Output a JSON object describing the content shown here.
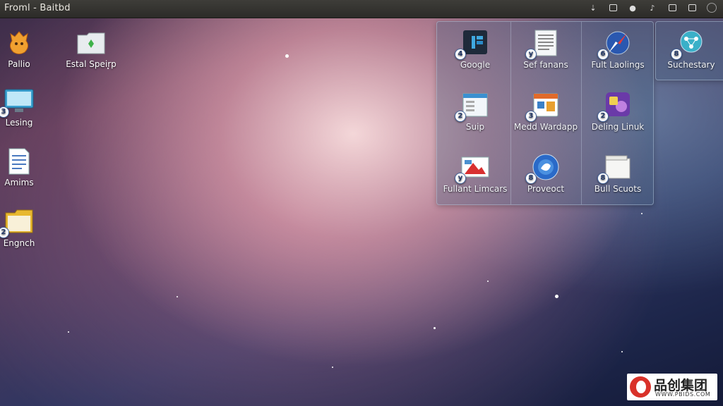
{
  "topbar": {
    "title": "Froml - Baitbd"
  },
  "desktop_icons": [
    {
      "label": "Pallio",
      "icon": "flame-mascot-icon",
      "badge": ""
    },
    {
      "label": "Estal Speirp",
      "icon": "folder-green-icon",
      "badge": ""
    },
    {
      "label": "Lesing",
      "icon": "monitor-icon",
      "badge": "3"
    },
    {
      "label": "Amims",
      "icon": "document-icon",
      "badge": ""
    },
    {
      "label": "Engnch",
      "icon": "folder-icon",
      "badge": "2"
    }
  ],
  "launcher": {
    "cells": [
      {
        "label": "Google",
        "icon": "app-window-icon",
        "badge": "4"
      },
      {
        "label": "Sef fanans",
        "icon": "text-document-icon",
        "badge": "y"
      },
      {
        "label": "Fult Laolings",
        "icon": "compass-icon",
        "badge": "6"
      },
      {
        "label": "Suip",
        "icon": "spreadsheet-icon",
        "badge": "2"
      },
      {
        "label": "Medd Wardapp",
        "icon": "media-app-icon",
        "badge": "3"
      },
      {
        "label": "Deling Linuk",
        "icon": "purple-app-icon",
        "badge": "2"
      },
      {
        "label": "Fullant Limcars",
        "icon": "image-viewer-icon",
        "badge": "y"
      },
      {
        "label": "Proveoct",
        "icon": "globe-icon",
        "badge": "8"
      },
      {
        "label": "Bull Scuots",
        "icon": "white-folder-icon",
        "badge": "8"
      }
    ],
    "extra": {
      "label": "Suchestary",
      "icon": "network-icon",
      "badge": "8"
    }
  },
  "watermark": {
    "text": "品创集团",
    "url": "WWW.PBIDS.COM"
  },
  "colors": {
    "accent": "#2f6fb2",
    "topbar": "#34332f"
  }
}
